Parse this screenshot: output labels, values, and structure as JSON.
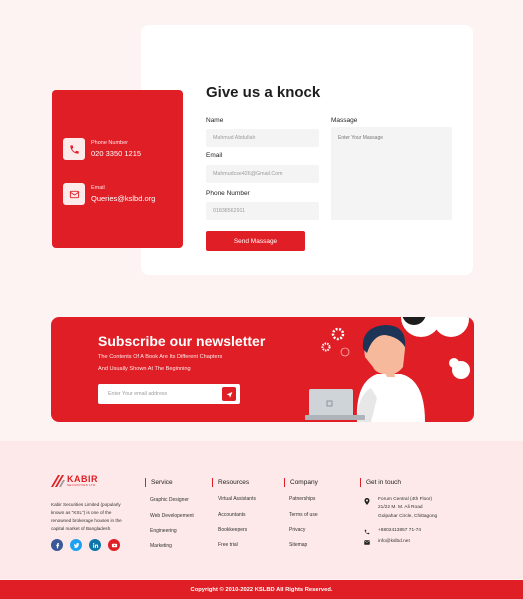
{
  "contact_card": {
    "phone_label": "Phone Number",
    "phone_value": "020 3350 1215",
    "email_label": "Email",
    "email_value": "Queries@kslbd.org"
  },
  "form": {
    "title": "Give us a knock",
    "name_label": "Name",
    "name_placeholder": "Mahmud Abdullah",
    "email_label": "Email",
    "email_placeholder": "Mahmudcse426@Gmail.Com",
    "phone_label": "Phone Number",
    "phone_placeholder": "01838562911",
    "message_label": "Massage",
    "message_placeholder": "Enter Your Massage",
    "send_label": "Send Massage"
  },
  "newsletter": {
    "title": "Subscribe our newsletter",
    "line1": "The Contents Of A Book Are Its Different Chapters",
    "line2": "And Usually Shown  At The Beginning",
    "input_placeholder": "Enter Your email address"
  },
  "footer": {
    "logo_text": "KABIR",
    "logo_sub": "SECURITIES LTD.",
    "about": "Kabir Securities Limited (popularly known as \"KSL\") is one of the renowned brokerage houses in the capital market of Bangladesh.",
    "columns": [
      {
        "title": "Service",
        "links": [
          "Graphic Designer",
          "Web Developement",
          "Engineering",
          "Marketing"
        ]
      },
      {
        "title": "Resources",
        "links": [
          "Virtual Assistants",
          "Accountants",
          "Bookkeepers",
          "Free trial"
        ]
      },
      {
        "title": "Company",
        "links": [
          "Patnerships",
          "Terms of use",
          "Privacy",
          "Sitemap"
        ]
      }
    ],
    "get_in_touch": {
      "title": "Get in touch",
      "address_lines": [
        "Forum Central (4th Floor)",
        "21/22 M. M. Ali Road",
        "Golpahar Circle, Chittagong"
      ],
      "phone": "+8802413857 71-74",
      "email": "info@kslbd.net"
    },
    "copyright": "Copyright ©  2010-2022 KSLBD All Rights Reserved."
  },
  "colors": {
    "brand_red": "#e01e25",
    "page_bg": "#fdf3f3",
    "footer_bg": "#fde9e9"
  },
  "icons": [
    "phone-icon",
    "mail-icon",
    "send-icon",
    "facebook-icon",
    "twitter-icon",
    "linkedin-icon",
    "youtube-icon",
    "location-icon"
  ]
}
